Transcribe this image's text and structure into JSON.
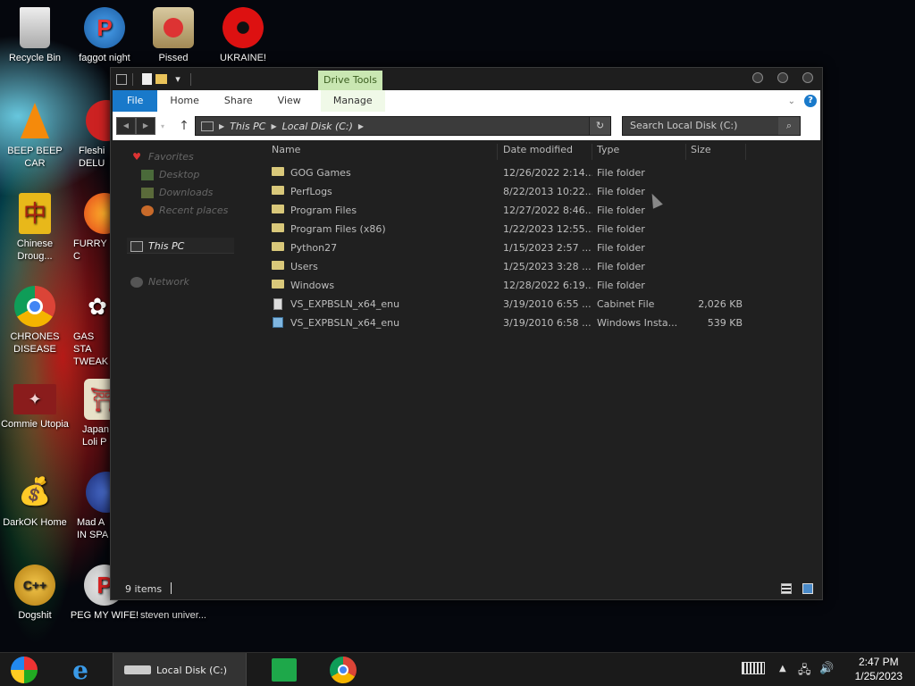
{
  "desktop": {
    "icons": [
      {
        "label": "Recycle Bin",
        "icon": "recycle-bin-icon"
      },
      {
        "label": "faggot night",
        "icon": "app-p-icon"
      },
      {
        "label": "Pissed",
        "icon": "seasons-bird-icon"
      },
      {
        "label": "UKRAINE!",
        "icon": "radiation-icon"
      },
      {
        "label": "BEEP BEEP CAR",
        "icon": "vlc-cone-icon"
      },
      {
        "label": "Fleshi DELU",
        "icon": "game-icon"
      },
      {
        "label": "Chinese Droug...",
        "icon": "chinese-icon"
      },
      {
        "label": "FURRY C",
        "icon": "firefox-icon"
      },
      {
        "label": "CHRONES DISEASE",
        "icon": "chrome-icon"
      },
      {
        "label": "GAS STA TWEAK",
        "icon": "flower-icon"
      },
      {
        "label": "Commie Utopia",
        "icon": "papers-icon"
      },
      {
        "label": "Japan Loli P",
        "icon": "torii-icon"
      },
      {
        "label": "DarkOK Home",
        "icon": "money-bag-icon"
      },
      {
        "label": "Mad A IN SPA",
        "icon": "angry-birds-icon"
      },
      {
        "label": "Dogshit",
        "icon": "cpp-icon"
      },
      {
        "label": "PEG MY WIFE!",
        "icon": "app-p-icon"
      },
      {
        "label": "steven univer...",
        "icon": "blank-icon"
      }
    ]
  },
  "window": {
    "contextual_tab_group": "Drive Tools",
    "ribbon_tabs": [
      "File",
      "Home",
      "Share",
      "View",
      "Manage"
    ],
    "address": {
      "segments": [
        "This PC",
        "Local Disk (C:)"
      ]
    },
    "search_placeholder": "Search Local Disk (C:)",
    "nav_pane": {
      "favorites": "Favorites",
      "desktop": "Desktop",
      "downloads": "Downloads",
      "recent": "Recent places",
      "this_pc": "This PC",
      "network": "Network"
    },
    "columns": [
      "Name",
      "Date modified",
      "Type",
      "Size"
    ],
    "files": [
      {
        "name": "GOG Games",
        "date": "12/26/2022 2:14...",
        "type": "File folder",
        "size": "",
        "kind": "folder"
      },
      {
        "name": "PerfLogs",
        "date": "8/22/2013 10:22...",
        "type": "File folder",
        "size": "",
        "kind": "folder"
      },
      {
        "name": "Program Files",
        "date": "12/27/2022 8:46...",
        "type": "File folder",
        "size": "",
        "kind": "folder"
      },
      {
        "name": "Program Files (x86)",
        "date": "1/22/2023 12:55...",
        "type": "File folder",
        "size": "",
        "kind": "folder"
      },
      {
        "name": "Python27",
        "date": "1/15/2023 2:57 ...",
        "type": "File folder",
        "size": "",
        "kind": "folder"
      },
      {
        "name": "Users",
        "date": "1/25/2023 3:28 ...",
        "type": "File folder",
        "size": "",
        "kind": "folder"
      },
      {
        "name": "Windows",
        "date": "12/28/2022 6:19...",
        "type": "File folder",
        "size": "",
        "kind": "folder"
      },
      {
        "name": "VS_EXPBSLN_x64_enu",
        "date": "3/19/2010 6:55 ...",
        "type": "Cabinet File",
        "size": "2,026 KB",
        "kind": "cab"
      },
      {
        "name": "VS_EXPBSLN_x64_enu",
        "date": "3/19/2010 6:58 ...",
        "type": "Windows Insta...",
        "size": "539 KB",
        "kind": "msi"
      }
    ],
    "status": {
      "items": "9 items"
    }
  },
  "taskbar": {
    "active_window": "Local Disk (C:)",
    "time": "2:47 PM",
    "date": "1/25/2023"
  },
  "colors": {
    "accent": "#1979ca",
    "drive_tools": "#c9e7b2",
    "window_bg": "#202020"
  }
}
